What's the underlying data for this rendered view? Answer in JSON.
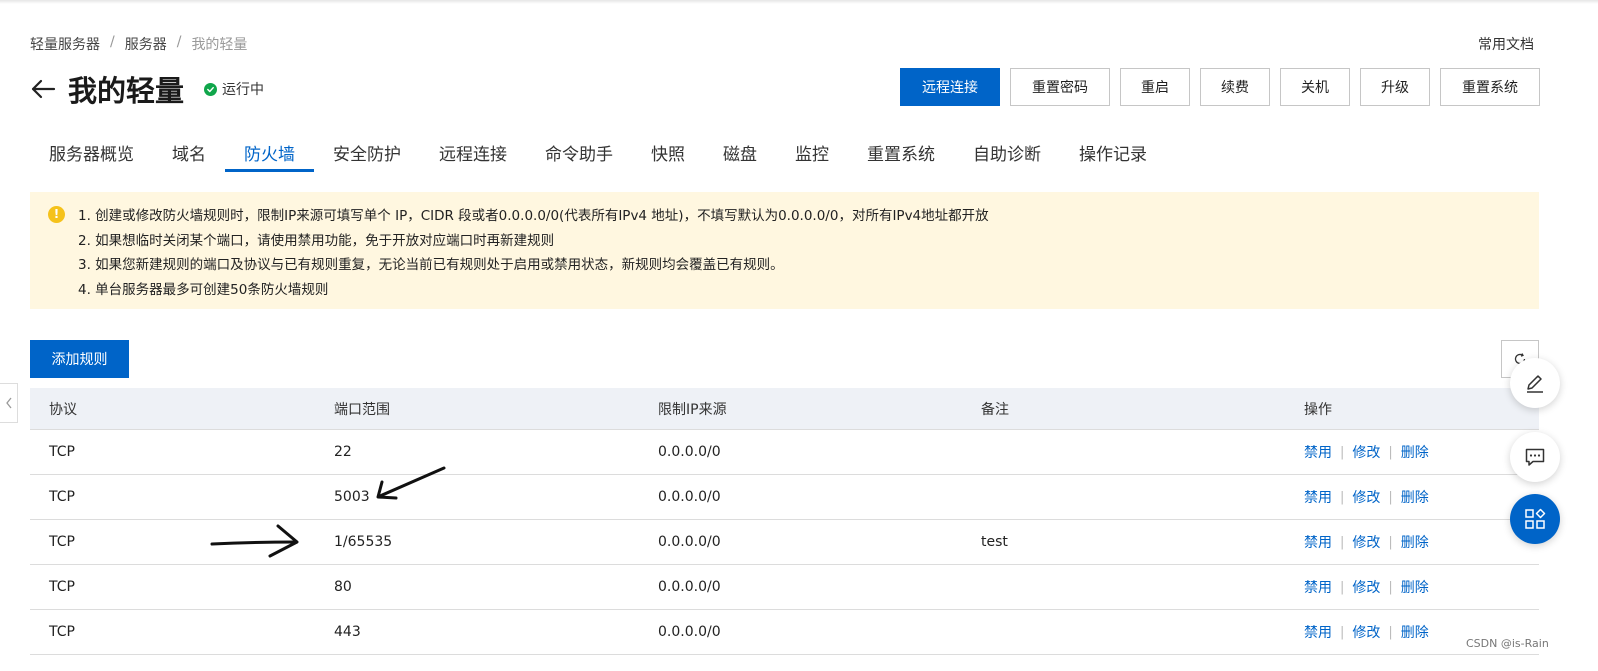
{
  "breadcrumb": [
    "轻量服务器",
    "服务器",
    "我的轻量"
  ],
  "breadcrumb_separator": "/",
  "doc_link": "常用文档",
  "page": {
    "title": "我的轻量",
    "status": "运行中"
  },
  "actions": [
    "远程连接",
    "重置密码",
    "重启",
    "续费",
    "关机",
    "升级",
    "重置系统"
  ],
  "tabs": [
    "服务器概览",
    "域名",
    "防火墙",
    "安全防护",
    "远程连接",
    "命令助手",
    "快照",
    "磁盘",
    "监控",
    "重置系统",
    "自助诊断",
    "操作记录"
  ],
  "active_tab": "防火墙",
  "notice": {
    "lines": [
      "1. 创建或修改防火墙规则时，限制IP来源可填写单个 IP，CIDR 段或者0.0.0.0/0(代表所有IPv4 地址)，不填写默认为0.0.0.0/0，对所有IPv4地址都开放",
      "2. 如果想临时关闭某个端口，请使用禁用功能，免于开放对应端口时再新建规则",
      "3. 如果您新建规则的端口及协议与已有规则重复，无论当前已有规则处于启用或禁用状态，新规则均会覆盖已有规则。",
      "4. 单台服务器最多可创建50条防火墙规则"
    ]
  },
  "add_rule_label": "添加规则",
  "table": {
    "columns": [
      "协议",
      "端口范围",
      "限制IP来源",
      "备注",
      "操作"
    ],
    "rows": [
      {
        "protocol": "TCP",
        "port": "22",
        "source": "0.0.0.0/0",
        "note": ""
      },
      {
        "protocol": "TCP",
        "port": "5003",
        "source": "0.0.0.0/0",
        "note": ""
      },
      {
        "protocol": "TCP",
        "port": "1/65535",
        "source": "0.0.0.0/0",
        "note": "test"
      },
      {
        "protocol": "TCP",
        "port": "80",
        "source": "0.0.0.0/0",
        "note": ""
      },
      {
        "protocol": "TCP",
        "port": "443",
        "source": "0.0.0.0/0",
        "note": ""
      }
    ],
    "ops": {
      "disable": "禁用",
      "edit": "修改",
      "delete": "删除",
      "separator": "|"
    }
  },
  "watermark": "CSDN @is-Rain",
  "colors": {
    "primary": "#0064c8",
    "notice_bg": "#fff7e0",
    "status_green": "#10a64b",
    "warning_yellow": "#f5c21b"
  },
  "icons": [
    "back-arrow-icon",
    "check-circle-icon",
    "warning-icon",
    "refresh-icon",
    "chevron-left-icon",
    "edit-icon",
    "chat-icon",
    "apps-icon"
  ]
}
